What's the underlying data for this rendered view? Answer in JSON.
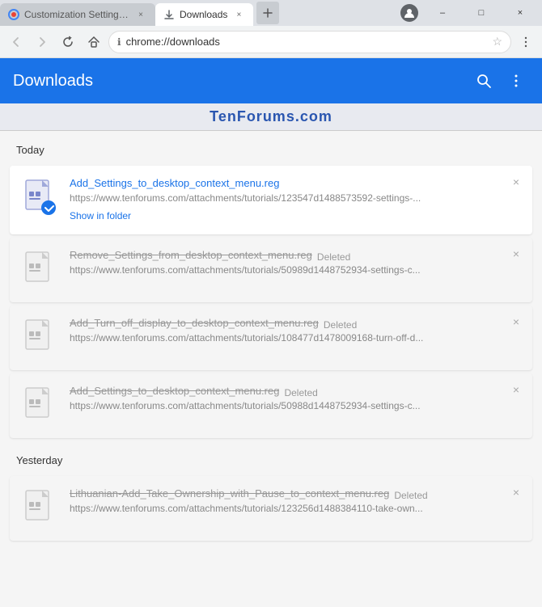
{
  "titleBar": {
    "tabs": [
      {
        "id": "tab-customization",
        "title": "Customization Settings c",
        "favicon": "gear",
        "active": false,
        "close_label": "×"
      },
      {
        "id": "tab-downloads",
        "title": "Downloads",
        "favicon": "download",
        "active": true,
        "close_label": "×"
      }
    ],
    "windowControls": {
      "minimize": "–",
      "maximize": "□",
      "close": "×"
    }
  },
  "addressBar": {
    "url": "chrome://downloads",
    "back_disabled": true,
    "forward_disabled": true
  },
  "header": {
    "title": "Downloads",
    "search_label": "Search",
    "menu_label": "More"
  },
  "watermark": "TenForums.com",
  "sections": [
    {
      "label": "Today",
      "items": [
        {
          "id": "item-1",
          "name": "Add_Settings_to_desktop_context_menu.reg",
          "url": "https://www.tenforums.com/attachments/tutorials/123547d1488573592-settings-...",
          "status": "downloaded",
          "action": "Show in folder",
          "deleted": false
        },
        {
          "id": "item-2",
          "name": "Remove_Settings_from_desktop_context_menu.reg",
          "url": "https://www.tenforums.com/attachments/tutorials/50989d1448752934-settings-c...",
          "status": "Deleted",
          "deleted": true
        },
        {
          "id": "item-3",
          "name": "Add_Turn_off_display_to_desktop_context_menu.reg",
          "url": "https://www.tenforums.com/attachments/tutorials/108477d1478009168-turn-off-d...",
          "status": "Deleted",
          "deleted": true
        },
        {
          "id": "item-4",
          "name": "Add_Settings_to_desktop_context_menu.reg",
          "url": "https://www.tenforums.com/attachments/tutorials/50988d1448752934-settings-c...",
          "status": "Deleted",
          "deleted": true
        }
      ]
    },
    {
      "label": "Yesterday",
      "items": [
        {
          "id": "item-5",
          "name": "Lithuanian-Add_Take_Ownership_with_Pause_to_context_menu.reg",
          "url": "https://www.tenforums.com/attachments/tutorials/123256d1488384110-take-own...",
          "status": "Deleted",
          "deleted": true
        }
      ]
    }
  ]
}
